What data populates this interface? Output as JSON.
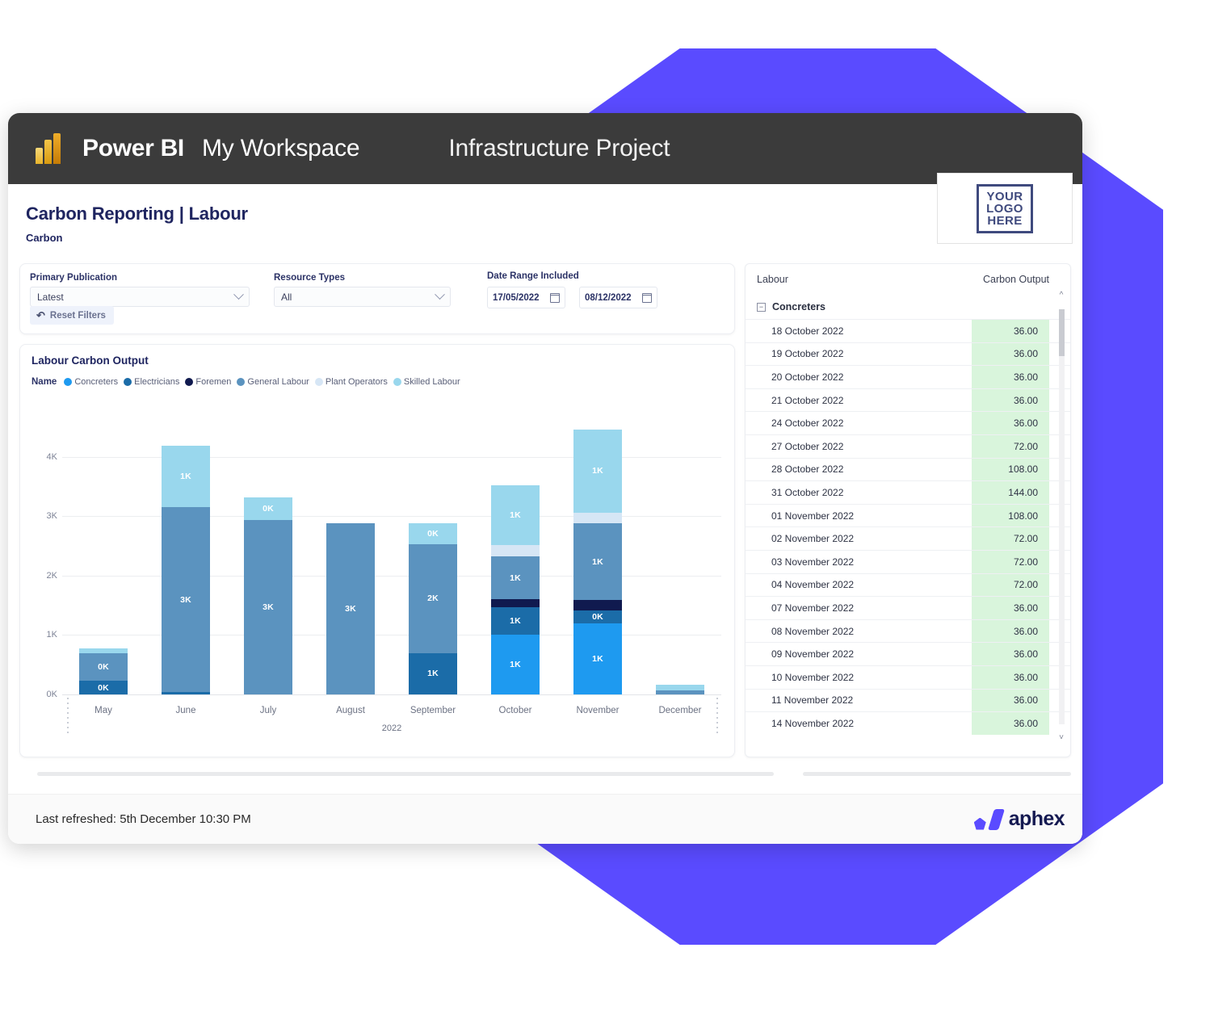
{
  "topnav": {
    "brand": "Power BI",
    "workspace": "My Workspace",
    "project": "Infrastructure Project",
    "logo_icon": "power-bi-logo-icon"
  },
  "report": {
    "title": "Carbon Reporting | Labour",
    "subtitle": "Carbon",
    "logo_placeholder": [
      "YOUR",
      "LOGO",
      "HERE"
    ]
  },
  "filters": {
    "primary_publication": {
      "label": "Primary Publication",
      "value": "Latest"
    },
    "resource_types": {
      "label": "Resource Types",
      "value": "All"
    },
    "date_range": {
      "label": "Date Range Included",
      "from": "17/05/2022",
      "to": "08/12/2022"
    },
    "reset_label": "Reset Filters"
  },
  "chart_data": {
    "type": "bar",
    "stacked": true,
    "title": "Labour Carbon Output",
    "legend_title": "Name",
    "legend_position": "top",
    "grid": true,
    "xlabel": "2022",
    "ylabel": "",
    "ylim": [
      0,
      4500
    ],
    "ytick_labels": [
      "0K",
      "1K",
      "2K",
      "3K",
      "4K"
    ],
    "ytick_values": [
      0,
      1000,
      2000,
      3000,
      4000
    ],
    "categories": [
      "May",
      "June",
      "July",
      "August",
      "September",
      "October",
      "November",
      "December"
    ],
    "series": [
      {
        "name": "Concreters",
        "color": "#1E9AF0",
        "values": [
          0,
          0,
          0,
          0,
          0,
          1000,
          1200,
          0
        ],
        "labels": [
          "",
          "",
          "",
          "",
          "",
          "1K",
          "1K",
          ""
        ]
      },
      {
        "name": "Electricians",
        "color": "#1B6CA8",
        "values": [
          230,
          40,
          0,
          0,
          700,
          470,
          220,
          0
        ],
        "labels": [
          "0K",
          "",
          "",
          "",
          "1K",
          "1K",
          "0K",
          ""
        ]
      },
      {
        "name": "Foremen",
        "color": "#101A4F",
        "values": [
          0,
          0,
          0,
          0,
          0,
          130,
          170,
          0
        ],
        "labels": [
          "",
          "",
          "",
          "",
          "",
          "0K",
          "0K",
          ""
        ]
      },
      {
        "name": "General Labour",
        "color": "#5B93BF",
        "values": [
          470,
          3110,
          2930,
          2880,
          1830,
          730,
          1290,
          70
        ],
        "labels": [
          "0K",
          "3K",
          "3K",
          "3K",
          "2K",
          "1K",
          "1K",
          "0K"
        ]
      },
      {
        "name": "Plant Operators",
        "color": "#D6E6F5",
        "values": [
          0,
          0,
          0,
          0,
          0,
          190,
          180,
          0
        ],
        "labels": [
          "",
          "",
          "",
          "",
          "",
          "0K",
          "0K",
          ""
        ]
      },
      {
        "name": "Skilled Labour",
        "color": "#99D7ED",
        "values": [
          80,
          1040,
          390,
          0,
          350,
          1000,
          1400,
          100
        ],
        "labels": [
          "",
          "1K",
          "0K",
          "",
          "0K",
          "1K",
          "1K",
          "0K"
        ]
      }
    ],
    "totals": [
      780,
      4190,
      3320,
      2880,
      2880,
      3520,
      4460,
      170
    ]
  },
  "table": {
    "columns": [
      "Labour",
      "Carbon Output"
    ],
    "group": {
      "label": "Concreters",
      "expander": "−"
    },
    "rows": [
      {
        "date": "18 October 2022",
        "value": "36.00"
      },
      {
        "date": "19 October 2022",
        "value": "36.00"
      },
      {
        "date": "20 October 2022",
        "value": "36.00"
      },
      {
        "date": "21 October 2022",
        "value": "36.00"
      },
      {
        "date": "24 October 2022",
        "value": "36.00"
      },
      {
        "date": "27 October 2022",
        "value": "72.00"
      },
      {
        "date": "28 October 2022",
        "value": "108.00"
      },
      {
        "date": "31 October 2022",
        "value": "144.00"
      },
      {
        "date": "01 November 2022",
        "value": "108.00"
      },
      {
        "date": "02 November 2022",
        "value": "72.00"
      },
      {
        "date": "03 November 2022",
        "value": "72.00"
      },
      {
        "date": "04 November 2022",
        "value": "72.00"
      },
      {
        "date": "07 November 2022",
        "value": "36.00"
      },
      {
        "date": "08 November 2022",
        "value": "36.00"
      },
      {
        "date": "09 November 2022",
        "value": "36.00"
      },
      {
        "date": "10 November 2022",
        "value": "36.00"
      },
      {
        "date": "11 November 2022",
        "value": "36.00"
      },
      {
        "date": "14 November 2022",
        "value": "36.00"
      }
    ]
  },
  "footer": {
    "last_refreshed": "Last refreshed:  5th December 10:30 PM",
    "brand": "aphex"
  },
  "colors": {
    "accent_purple": "#5A4BFF",
    "navy": "#1F2560",
    "nav_bg": "#3B3B3B",
    "value_cell": "#D9F5DC"
  }
}
